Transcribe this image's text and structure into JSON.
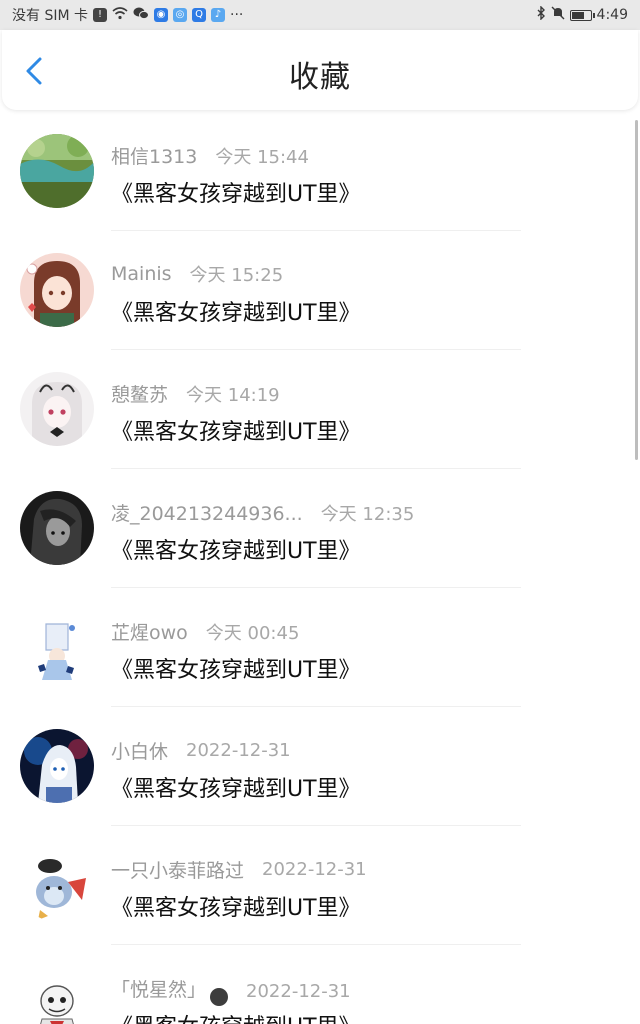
{
  "status_bar": {
    "left_text": "没有 SIM 卡",
    "time": "4:49",
    "icons_left": [
      "sim-warning-icon",
      "wifi-icon",
      "wechat-icon",
      "app-icon",
      "browser-icon",
      "search-app-icon",
      "music-app-icon"
    ],
    "ellipsis": "···",
    "icons_right": [
      "bluetooth-icon",
      "mute-icon",
      "battery-icon"
    ]
  },
  "header": {
    "title": "收藏",
    "back_icon": "chevron-left-icon",
    "accent_color": "#2f8ae5"
  },
  "items": [
    {
      "user": "相信1313",
      "time": "今天 15:44",
      "title": "《黑客女孩穿越到UT里》"
    },
    {
      "user": "Mainis",
      "time": "今天 15:25",
      "title": "《黑客女孩穿越到UT里》"
    },
    {
      "user": "憩鳌苏",
      "time": "今天 14:19",
      "title": "《黑客女孩穿越到UT里》"
    },
    {
      "user": "凌_204213244936...",
      "time": "今天 12:35",
      "title": "《黑客女孩穿越到UT里》"
    },
    {
      "user": "芷煋owo",
      "time": "今天 00:45",
      "title": "《黑客女孩穿越到UT里》"
    },
    {
      "user": "小白休",
      "time": "2022-12-31",
      "title": "《黑客女孩穿越到UT里》"
    },
    {
      "user": "一只小泰菲路过",
      "time": "2022-12-31",
      "title": "《黑客女孩穿越到UT里》"
    },
    {
      "user": "「悦星然」",
      "time": "2022-12-31",
      "title": "《黑客女孩穿越到UT里》"
    }
  ]
}
